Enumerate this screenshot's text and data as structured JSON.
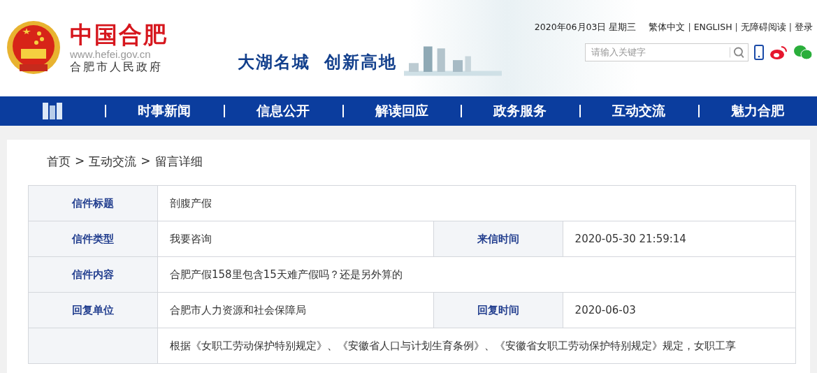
{
  "header": {
    "title": "中国合肥",
    "url": "www.hefei.gov.cn",
    "subtitle": "合肥市人民政府",
    "slogan": [
      "大湖名城",
      "创新高地"
    ],
    "date": "2020年06月03日 星期三",
    "links": [
      "繁体中文",
      "ENGLISH",
      "无障碍阅读",
      "登录"
    ],
    "link_separator": "|",
    "search": {
      "placeholder": "请输入关键字"
    }
  },
  "nav": [
    "时事新闻",
    "信息公开",
    "解读回应",
    "政务服务",
    "互动交流",
    "魅力合肥"
  ],
  "breadcrumb": [
    "首页",
    "互动交流",
    "留言详细"
  ],
  "breadcrumb_separator": ">",
  "rows": [
    {
      "cells": [
        {
          "label": "信件标题",
          "value": "剖腹产假"
        }
      ]
    },
    {
      "cells": [
        {
          "label": "信件类型",
          "value": "我要咨询"
        },
        {
          "label": "来信时间",
          "value": "2020-05-30 21:59:14"
        }
      ]
    },
    {
      "cells": [
        {
          "label": "信件内容",
          "value": "合肥产假158里包含15天难产假吗？还是另外算的"
        }
      ]
    },
    {
      "cells": [
        {
          "label": "回复单位",
          "value": "合肥市人力资源和社会保障局"
        },
        {
          "label": "回复时间",
          "value": "2020-06-03"
        }
      ]
    },
    {
      "cells": [
        {
          "value": "根据《女职工劳动保护特别规定》、《安徽省人口与计划生育条例》、《安徽省女职工劳动保护特别规定》规定，女职工享"
        }
      ]
    }
  ]
}
